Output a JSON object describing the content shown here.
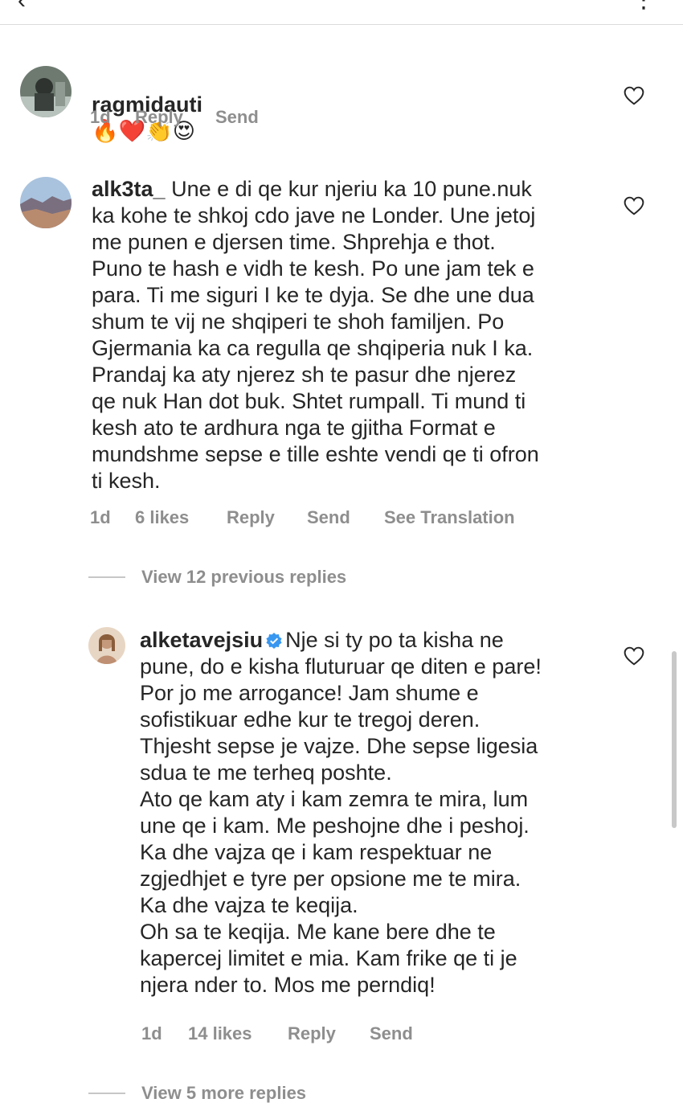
{
  "comments": [
    {
      "username": "ragmidauti",
      "text": "🔥❤️👏😍",
      "time": "1d",
      "likes": "",
      "reply_label": "Reply",
      "send_label": "Send",
      "translate_label": ""
    },
    {
      "username": "alk3ta_",
      "text": "Une e di qe kur njeriu ka 10 pune.nuk\nka kohe te shkoj cdo jave ne Londer. Une jetoj\nme punen e djersen time. Shprehja e thot.\nPuno te hash e vidh te kesh. Po une jam tek e\npara.  Ti me siguri I ke te dyja. Se dhe une dua\nshum te vij ne shqiperi te shoh familjen. Po\nGjermania ka ca regulla qe shqiperia nuk I ka.\nPrandaj ka aty  njerez sh te pasur dhe njerez\nqe nuk Han dot buk. Shtet rumpall. Ti mund ti\nkesh ato te ardhura nga te gjitha Format e\nmundshme sepse e tille eshte vendi qe ti ofron\nti kesh.",
      "time": "1d",
      "likes": "6 likes",
      "reply_label": "Reply",
      "send_label": "Send",
      "translate_label": "See Translation"
    },
    {
      "username": "alketavejsiu",
      "text": "Nje si ty po ta kisha ne\npune, do e kisha fluturuar qe diten e pare!\nPor jo me arrogance! Jam shume e\nsofistikuar edhe kur te tregoj deren.\nThjesht sepse je vajze. Dhe sepse ligesia\nsdua te me terheq poshte.\nAto qe kam aty i kam zemra te mira, lum\nune qe i kam. Me peshojne dhe i peshoj.\nKa dhe vajza qe i kam respektuar ne\nzgjedhjet e tyre per opsione me te mira.\nKa dhe vajza te keqija.\nOh sa te keqija. Me kane bere dhe te\nkapercej limitet e mia. Kam frike qe ti je\nnjera nder to. Mos me perndiq!",
      "time": "1d",
      "likes": "14 likes",
      "reply_label": "Reply",
      "send_label": "Send",
      "translate_label": ""
    }
  ],
  "view_previous_replies": "View 12 previous replies",
  "view_more_replies": "View 5 more replies",
  "colors": {
    "text": "#262626",
    "muted": "#8e8e8e",
    "verified": "#3897f0",
    "divider": "#dbdbdb"
  },
  "icons": [
    "back-arrow-icon",
    "more-options-icon",
    "heart-outline-icon",
    "verified-badge-icon"
  ]
}
